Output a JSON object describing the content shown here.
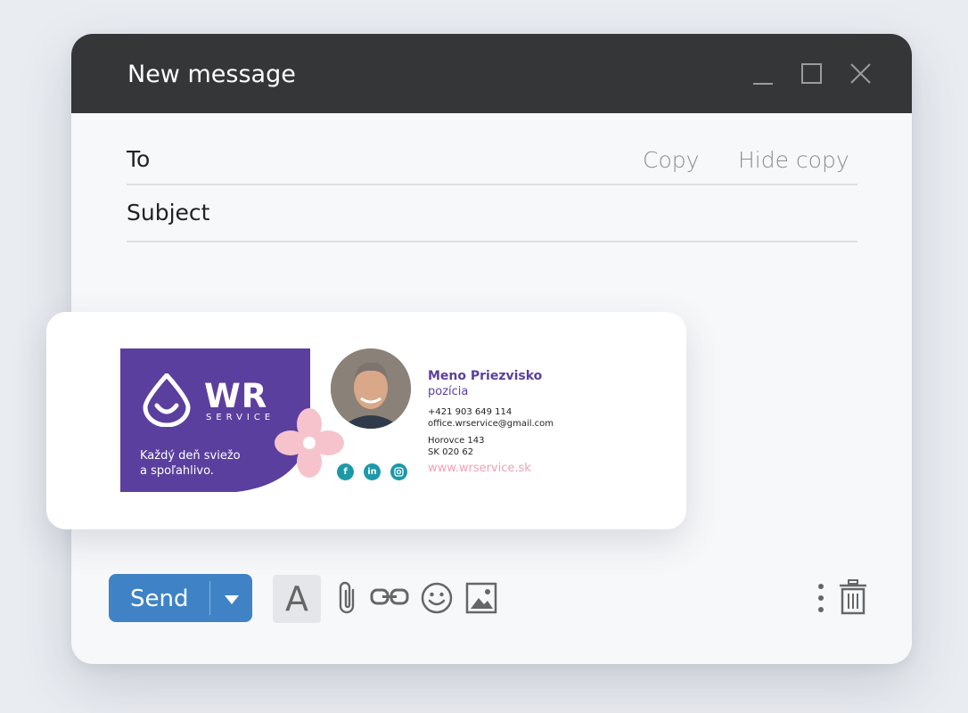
{
  "window": {
    "title": "New message",
    "controls": [
      "minimize-icon",
      "maximize-icon",
      "close-icon"
    ]
  },
  "compose": {
    "to_label": "To",
    "subject_label": "Subject",
    "copy_label": "Copy",
    "hide_copy_label": "Hide copy"
  },
  "signature": {
    "logo_text": "WR",
    "logo_sub": "SERVICE",
    "tagline_line1": "Každý deň sviežo",
    "tagline_line2": "a spoľahlivo.",
    "name": "Meno Priezvisko",
    "position": "pozícia",
    "phone": "+421 903 649 114",
    "email": "office.wrservice@gmail.com",
    "address_line1": "Horovce 143",
    "address_line2": "SK 020 62",
    "website": "www.wrservice.sk",
    "socials": [
      "facebook-icon",
      "linkedin-icon",
      "instagram-icon"
    ],
    "brand_color": "#5b3f9e",
    "accent_pink": "#f2a0b2",
    "social_color": "#1c99a8"
  },
  "toolbar": {
    "send_label": "Send",
    "font_label": "A",
    "send_color": "#3f83c6",
    "tools": [
      "formatting-icon",
      "attach-icon",
      "link-icon",
      "emoji-icon",
      "image-icon",
      "more-options-icon",
      "trash-icon"
    ]
  }
}
